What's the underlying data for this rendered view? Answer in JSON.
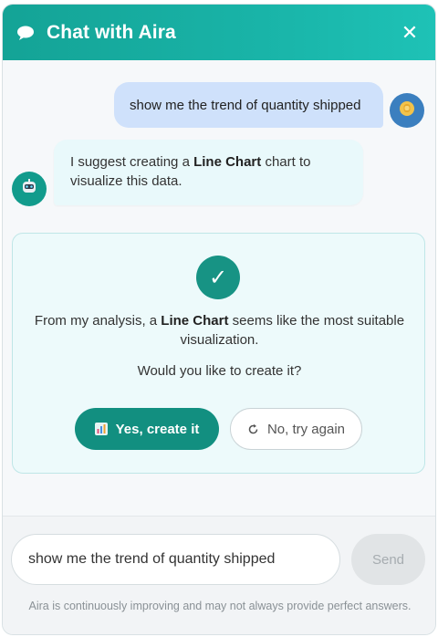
{
  "header": {
    "title": "Chat with Aira",
    "close_label": "✕"
  },
  "messages": {
    "user_text": "show me the trend of quantity shipped",
    "bot_prefix": "I suggest creating a ",
    "bot_bold": "Line Chart",
    "bot_suffix": " chart to visualize this data."
  },
  "card": {
    "text_prefix": "From my analysis, a ",
    "text_bold": "Line Chart",
    "text_suffix": " seems like the most suitable visualization.",
    "question": "Would you like to create it?",
    "check_glyph": "✓",
    "yes_label": "Yes, create it",
    "no_label": "No, try again"
  },
  "composer": {
    "input_value": "show me the trend of quantity shipped",
    "send_label": "Send",
    "disclaimer": "Aira is continuously improving and may not always provide perfect answers."
  },
  "colors": {
    "header_start": "#14a396",
    "header_end": "#1ec2b6",
    "accent": "#128f80",
    "user_bubble": "#cfe1fb",
    "bot_bubble": "#e9f9fb",
    "card_bg": "#edfafb"
  },
  "icons": {
    "header": "chat-bubble-icon",
    "user_avatar": "user-avatar-icon",
    "bot_avatar": "robot-icon",
    "check": "checkmark-icon",
    "yes_button": "bar-chart-icon",
    "no_button": "retry-icon"
  }
}
